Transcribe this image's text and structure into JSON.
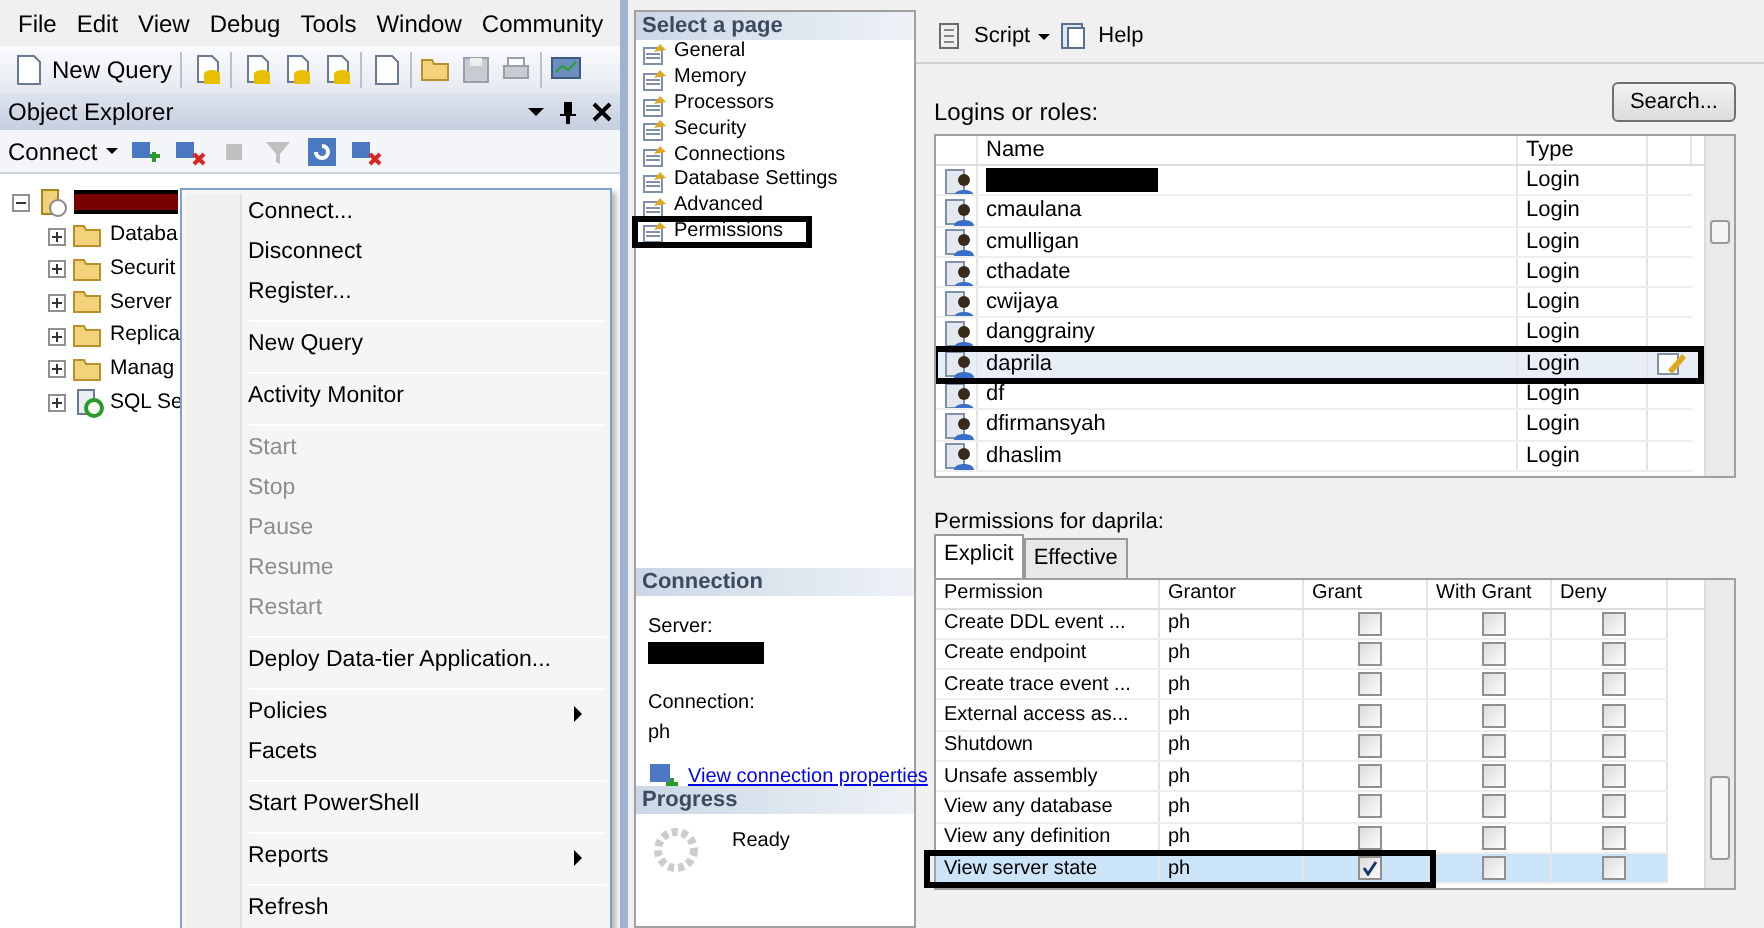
{
  "menu_bar": [
    {
      "label": "File"
    },
    {
      "label": "Edit"
    },
    {
      "label": "View"
    },
    {
      "label": "Debug"
    },
    {
      "label": "Tools"
    },
    {
      "label": "Window"
    },
    {
      "label": "Community"
    }
  ],
  "toolbar": {
    "new_query": "New Query"
  },
  "object_explorer": {
    "title": "Object Explorer",
    "connect": "Connect",
    "tree": [
      {
        "kind": "server",
        "expanded": true,
        "children": [
          {
            "label": "Databa",
            "kind": "folder",
            "expanded": false
          },
          {
            "label": "Securit",
            "kind": "folder",
            "expanded": false
          },
          {
            "label": "Server",
            "kind": "folder",
            "expanded": false
          },
          {
            "label": "Replica",
            "kind": "folder",
            "expanded": false
          },
          {
            "label": "Manag",
            "kind": "folder",
            "expanded": false
          },
          {
            "label": "SQL Se",
            "kind": "agent",
            "expanded": false
          }
        ]
      }
    ]
  },
  "context_menu": [
    {
      "kind": "item",
      "label": "Connect...",
      "disabled": false
    },
    {
      "kind": "item",
      "label": "Disconnect",
      "disabled": false
    },
    {
      "kind": "item",
      "label": "Register...",
      "disabled": false
    },
    {
      "kind": "separator"
    },
    {
      "kind": "item",
      "label": "New Query",
      "disabled": false
    },
    {
      "kind": "separator"
    },
    {
      "kind": "item",
      "label": "Activity Monitor",
      "disabled": false
    },
    {
      "kind": "separator"
    },
    {
      "kind": "item",
      "label": "Start",
      "disabled": true
    },
    {
      "kind": "item",
      "label": "Stop",
      "disabled": true
    },
    {
      "kind": "item",
      "label": "Pause",
      "disabled": true
    },
    {
      "kind": "item",
      "label": "Resume",
      "disabled": true
    },
    {
      "kind": "item",
      "label": "Restart",
      "disabled": true
    },
    {
      "kind": "separator"
    },
    {
      "kind": "item",
      "label": "Deploy Data-tier Application...",
      "disabled": false
    },
    {
      "kind": "separator"
    },
    {
      "kind": "submenu",
      "label": "Policies",
      "disabled": false
    },
    {
      "kind": "item",
      "label": "Facets",
      "disabled": false
    },
    {
      "kind": "separator"
    },
    {
      "kind": "item",
      "label": "Start PowerShell",
      "disabled": false
    },
    {
      "kind": "separator"
    },
    {
      "kind": "submenu",
      "label": "Reports",
      "disabled": false
    },
    {
      "kind": "separator"
    },
    {
      "kind": "item",
      "label": "Refresh",
      "disabled": false
    }
  ],
  "dialog": {
    "pages_header": "Select a page",
    "pages": [
      {
        "label": "General",
        "selected": false
      },
      {
        "label": "Memory",
        "selected": false
      },
      {
        "label": "Processors",
        "selected": false
      },
      {
        "label": "Security",
        "selected": false
      },
      {
        "label": "Connections",
        "selected": false
      },
      {
        "label": "Database Settings",
        "selected": false
      },
      {
        "label": "Advanced",
        "selected": false
      },
      {
        "label": "Permissions",
        "selected": true
      }
    ],
    "connection": {
      "header": "Connection",
      "server_label": "Server:",
      "connection_label": "Connection:",
      "connection_value": "ph",
      "link": "View connection properties"
    },
    "progress": {
      "header": "Progress",
      "status": "Ready"
    },
    "toolbar": {
      "script": "Script",
      "help": "Help"
    },
    "logins_label": "Logins or roles:",
    "search": "Search...",
    "logins_columns": [
      "Name",
      "Type"
    ],
    "logins": [
      {
        "kind": "redacted",
        "type": "Login",
        "selected": false
      },
      {
        "kind": "login",
        "name": "cmaulana",
        "type": "Login",
        "selected": false
      },
      {
        "kind": "login",
        "name": "cmulligan",
        "type": "Login",
        "selected": false
      },
      {
        "kind": "login",
        "name": "cthadate",
        "type": "Login",
        "selected": false
      },
      {
        "kind": "login",
        "name": "cwijaya",
        "type": "Login",
        "selected": false
      },
      {
        "kind": "login",
        "name": "danggrainy",
        "type": "Login",
        "selected": false
      },
      {
        "kind": "login",
        "name": "daprila",
        "type": "Login",
        "selected": true
      },
      {
        "kind": "login",
        "name": "df",
        "type": "Login",
        "selected": false
      },
      {
        "kind": "login",
        "name": "dfirmansyah",
        "type": "Login",
        "selected": false
      },
      {
        "kind": "login",
        "name": "dhaslim",
        "type": "Login",
        "selected": false
      }
    ],
    "permissions_label": "Permissions for daprila:",
    "tabs": [
      {
        "label": "Explicit",
        "selected": true
      },
      {
        "label": "Effective",
        "selected": false
      }
    ],
    "permission_columns": [
      "Permission",
      "Grantor",
      "Grant",
      "With Grant",
      "Deny"
    ],
    "permissions": [
      {
        "permission": "Create DDL event ...",
        "grantor": "ph",
        "grant": false,
        "with_grant": false,
        "deny": false,
        "selected": false
      },
      {
        "permission": "Create endpoint",
        "grantor": "ph",
        "grant": false,
        "with_grant": false,
        "deny": false,
        "selected": false
      },
      {
        "permission": "Create trace event ...",
        "grantor": "ph",
        "grant": false,
        "with_grant": false,
        "deny": false,
        "selected": false
      },
      {
        "permission": "External access as...",
        "grantor": "ph",
        "grant": false,
        "with_grant": false,
        "deny": false,
        "selected": false
      },
      {
        "permission": "Shutdown",
        "grantor": "ph",
        "grant": false,
        "with_grant": false,
        "deny": false,
        "selected": false
      },
      {
        "permission": "Unsafe assembly",
        "grantor": "ph",
        "grant": false,
        "with_grant": false,
        "deny": false,
        "selected": false
      },
      {
        "permission": "View any database",
        "grantor": "ph",
        "grant": false,
        "with_grant": false,
        "deny": false,
        "selected": false
      },
      {
        "permission": "View any definition",
        "grantor": "ph",
        "grant": false,
        "with_grant": false,
        "deny": false,
        "selected": false
      },
      {
        "permission": "View server state",
        "grantor": "ph",
        "grant": true,
        "with_grant": false,
        "deny": false,
        "selected": true
      }
    ]
  }
}
